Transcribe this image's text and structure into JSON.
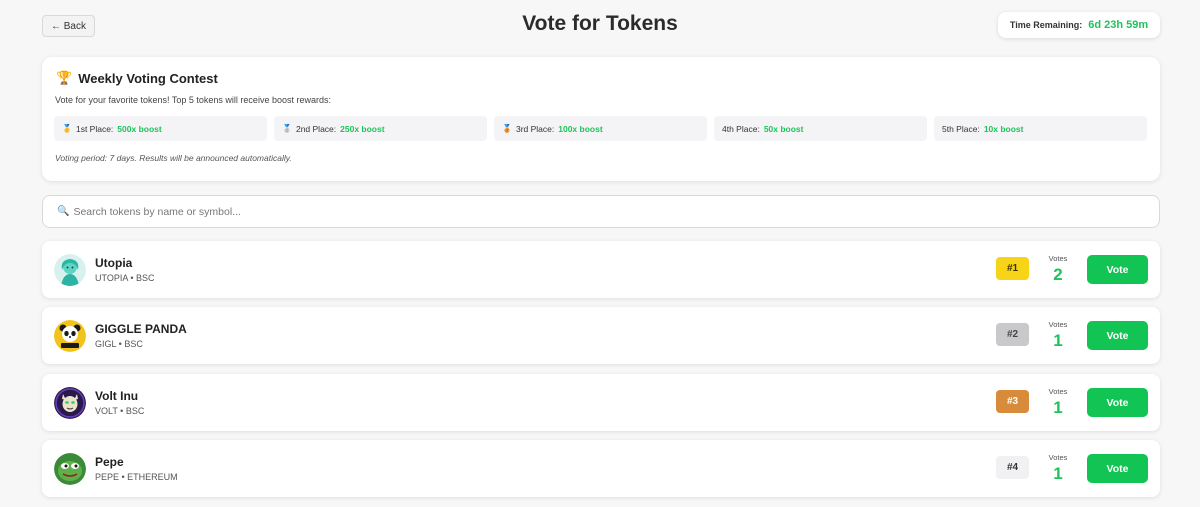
{
  "header": {
    "back_label": "← Back",
    "title": "Vote for Tokens",
    "timer_label": "Time Remaining:",
    "timer_value": "6d 23h 59m"
  },
  "contest": {
    "trophy_icon": "trophy-icon",
    "title": "Weekly Voting Contest",
    "description": "Vote for your favorite tokens! Top 5 tokens will receive boost rewards:",
    "prizes": [
      {
        "medal": "🥇",
        "label": "1st Place:",
        "boost": "500x boost"
      },
      {
        "medal": "🥈",
        "label": "2nd Place:",
        "boost": "250x boost"
      },
      {
        "medal": "🥉",
        "label": "3rd Place:",
        "boost": "100x boost"
      },
      {
        "label": "4th Place:",
        "boost": "50x boost"
      },
      {
        "label": "5th Place:",
        "boost": "10x boost"
      }
    ],
    "note": "Voting period: 7 days. Results will be announced automatically."
  },
  "search": {
    "placeholder": "Search tokens by name or symbol...",
    "value": ""
  },
  "tokens_votes_label": "Votes",
  "vote_label": "Vote",
  "colors": {
    "accent_green": "#12c453",
    "rank1": "#f7d417",
    "rank2": "#c9c9cb",
    "rank3": "#d98b3c",
    "rank_default": "#f1f1f3"
  },
  "tokens": [
    {
      "name": "Utopia",
      "symbol": "UTOPIA",
      "chain": "BSC",
      "meta": "UTOPIA • BSC",
      "rank": "#1",
      "votes": "2"
    },
    {
      "name": "GIGGLE PANDA",
      "symbol": "GIGL",
      "chain": "BSC",
      "meta": "GIGL • BSC",
      "rank": "#2",
      "votes": "1"
    },
    {
      "name": "Volt Inu",
      "symbol": "VOLT",
      "chain": "BSC",
      "meta": "VOLT • BSC",
      "rank": "#3",
      "votes": "1"
    },
    {
      "name": "Pepe",
      "symbol": "PEPE",
      "chain": "ETHEREUM",
      "meta": "PEPE • ETHEREUM",
      "rank": "#4",
      "votes": "1"
    }
  ]
}
